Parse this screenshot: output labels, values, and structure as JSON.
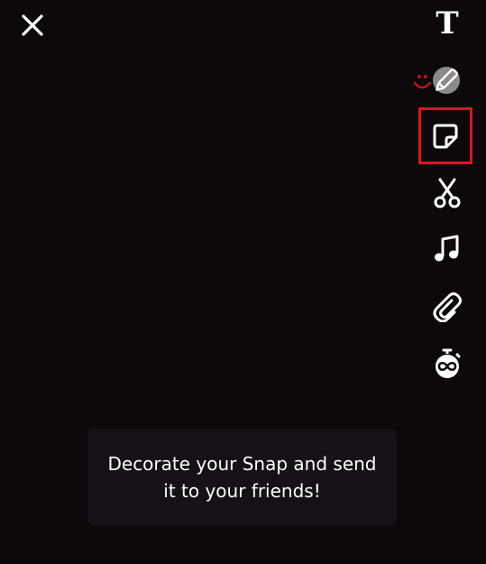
{
  "colors": {
    "background": "#0d080c",
    "icon": "#ffffff",
    "highlight": "#e0141e",
    "tooltip_background": "#161117",
    "emoji_accent": "#c0141a"
  },
  "header": {
    "close_icon": "close-icon"
  },
  "toolbar": {
    "items": [
      {
        "name": "text-tool",
        "icon": "text-t-icon",
        "glyph": "T",
        "selected": false
      },
      {
        "name": "draw-tool",
        "icon": "pencil-icon",
        "selected": false
      },
      {
        "name": "sticker-tool",
        "icon": "sticker-icon",
        "selected": true
      },
      {
        "name": "scissors-tool",
        "icon": "scissors-icon",
        "selected": false
      },
      {
        "name": "music-tool",
        "icon": "music-note-icon",
        "glyph": "♫",
        "selected": false
      },
      {
        "name": "attachment-tool",
        "icon": "paperclip-icon",
        "selected": false
      },
      {
        "name": "timer-tool",
        "icon": "timer-infinity-icon",
        "selected": false
      }
    ]
  },
  "tooltip": {
    "text": "Decorate your Snap and send it to your friends!"
  }
}
